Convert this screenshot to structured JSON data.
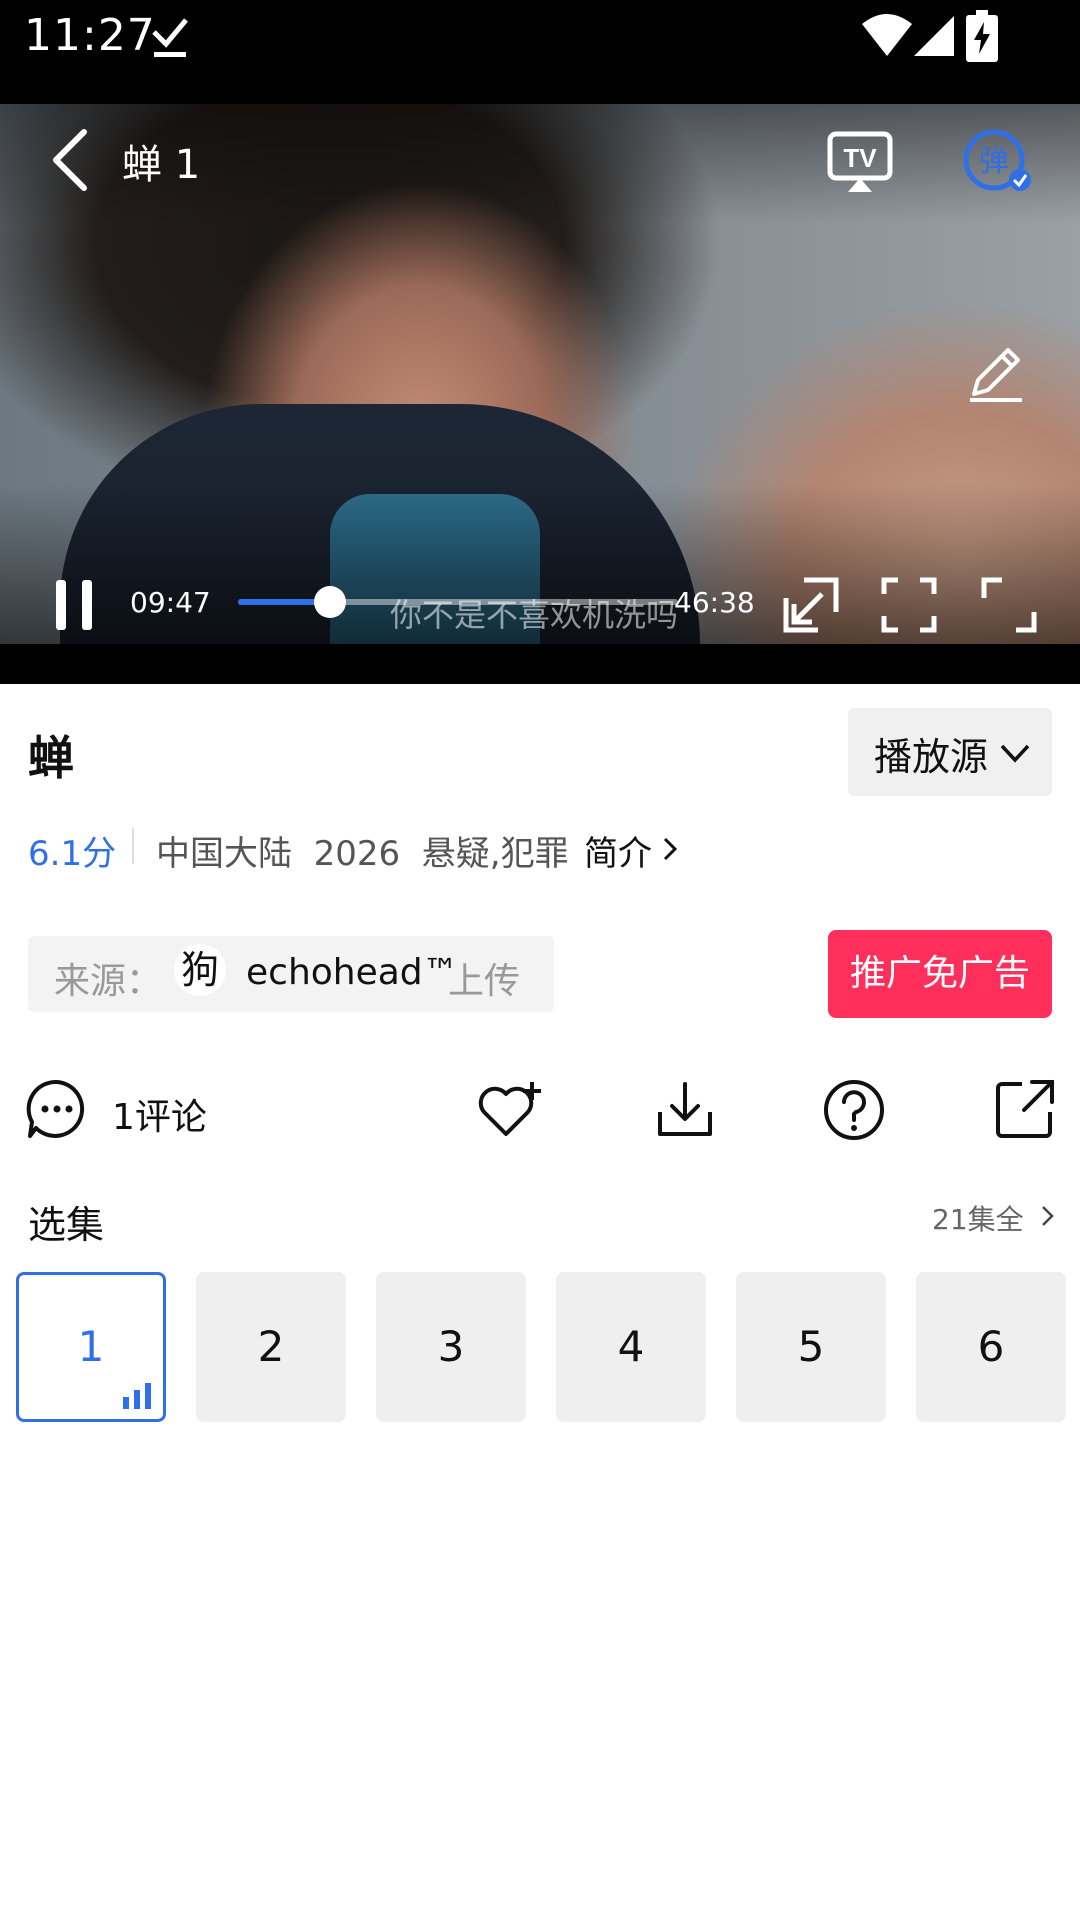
{
  "status_bar": {
    "time": "11:27",
    "icons": [
      "download-done-icon",
      "wifi-icon",
      "signal-icon",
      "battery-charging-icon"
    ]
  },
  "player": {
    "title": "蝉 1",
    "current_time": "09:47",
    "total_time": "46:38",
    "progress": 0.21,
    "subtitle": "你不是不喜欢机洗吗",
    "accent_color": "#2f6fe8",
    "danmaku_label": "弹"
  },
  "info": {
    "title": "蝉",
    "source_button": "播放源",
    "rating": "6.1分",
    "meta": "中国大陆  2026  悬疑,犯罪",
    "intro_link": "简介",
    "uploader_prefix": "来源：",
    "uploader_avatar": "狗",
    "uploader_name": "echohead™",
    "uploader_suffix": "上传",
    "promo_button": "推广免广告",
    "promo_color": "#ff2f5b"
  },
  "actions": {
    "comment_count": "1评论"
  },
  "episodes": {
    "title": "选集",
    "total": "21集全",
    "items": [
      "1",
      "2",
      "3",
      "4",
      "5",
      "6"
    ],
    "active_index": 0
  }
}
